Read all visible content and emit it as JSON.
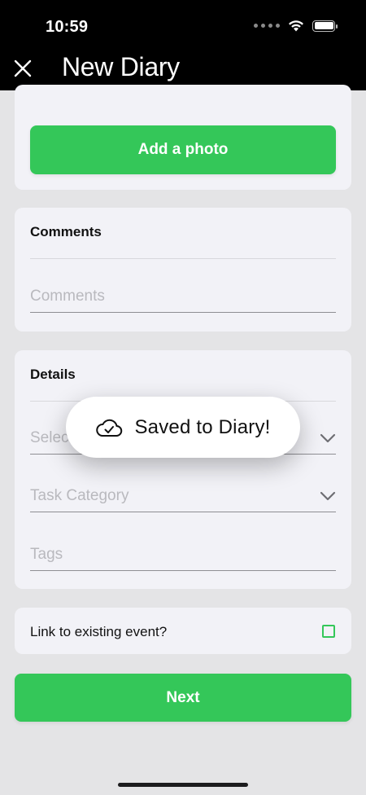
{
  "status_bar": {
    "time": "10:59"
  },
  "header": {
    "title": "New Diary",
    "close_icon": "close-icon"
  },
  "photo_card": {
    "add_photo_label": "Add a photo"
  },
  "comments_card": {
    "title": "Comments",
    "placeholder": "Comments"
  },
  "details_card": {
    "title": "Details",
    "select_placeholder": "Select",
    "task_category_placeholder": "Task Category",
    "tags_placeholder": "Tags"
  },
  "link_card": {
    "label": "Link to existing event?",
    "checked": false
  },
  "next_button": {
    "label": "Next"
  },
  "toast": {
    "text": "Saved to Diary!",
    "icon": "cloud-check-icon"
  },
  "colors": {
    "accent": "#34c759",
    "header_bg": "#000000",
    "card_bg": "#f2f2f7",
    "page_bg": "#e4e4e6"
  }
}
